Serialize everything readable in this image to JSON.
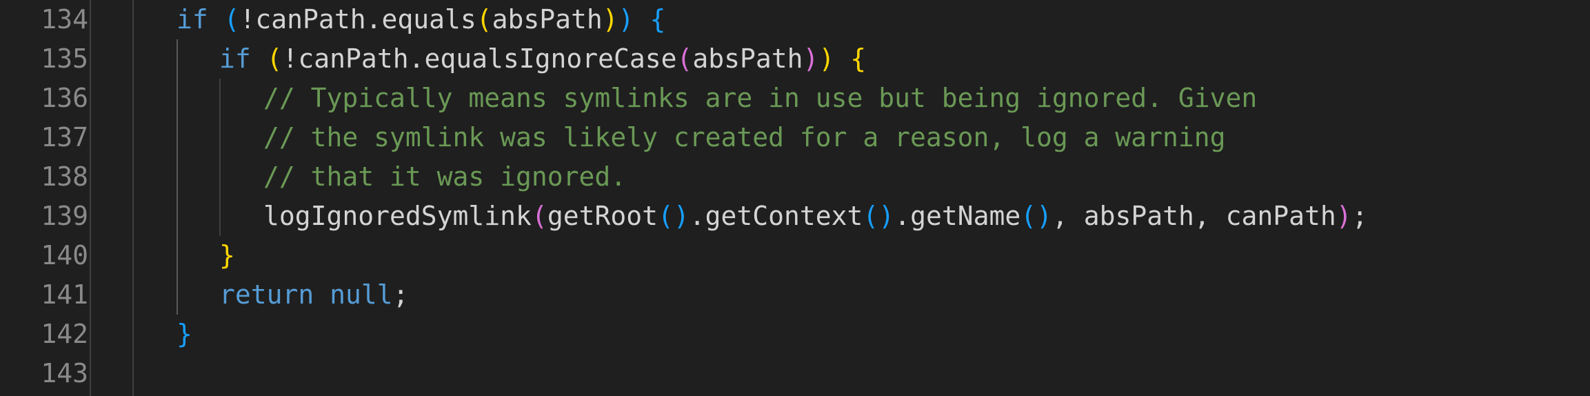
{
  "editor": {
    "line_numbers": [
      "134",
      "135",
      "136",
      "137",
      "138",
      "139",
      "140",
      "141",
      "142",
      "143"
    ],
    "colors": {
      "background": "#1f1f1f",
      "line_number": "#8a8a8a",
      "keyword": "#569cd6",
      "identifier": "#d4d4d4",
      "comment": "#6a9955",
      "bracket_level_1": "#ffd700",
      "bracket_level_2": "#da70d6",
      "bracket_level_3": "#179fff"
    },
    "lines": [
      {
        "number": "134",
        "tokens": [
          {
            "t": "if",
            "c": "kw"
          },
          {
            "t": " ",
            "c": "id"
          },
          {
            "t": "(",
            "c": "b3"
          },
          {
            "t": "!canPath.equals",
            "c": "id"
          },
          {
            "t": "(",
            "c": "b1"
          },
          {
            "t": "absPath",
            "c": "id"
          },
          {
            "t": ")",
            "c": "b1"
          },
          {
            "t": ")",
            "c": "b3"
          },
          {
            "t": " ",
            "c": "id"
          },
          {
            "t": "{",
            "c": "b3"
          }
        ]
      },
      {
        "number": "135",
        "tokens": [
          {
            "t": "if",
            "c": "kw"
          },
          {
            "t": " ",
            "c": "id"
          },
          {
            "t": "(",
            "c": "b1"
          },
          {
            "t": "!canPath.equalsIgnoreCase",
            "c": "id"
          },
          {
            "t": "(",
            "c": "b2"
          },
          {
            "t": "absPath",
            "c": "id"
          },
          {
            "t": ")",
            "c": "b2"
          },
          {
            "t": ")",
            "c": "b1"
          },
          {
            "t": " ",
            "c": "id"
          },
          {
            "t": "{",
            "c": "b1"
          }
        ]
      },
      {
        "number": "136",
        "tokens": [
          {
            "t": "// Typically means symlinks are in use but being ignored. Given",
            "c": "cm"
          }
        ]
      },
      {
        "number": "137",
        "tokens": [
          {
            "t": "// the symlink was likely created for a reason, log a warning",
            "c": "cm"
          }
        ]
      },
      {
        "number": "138",
        "tokens": [
          {
            "t": "// that it was ignored.",
            "c": "cm"
          }
        ]
      },
      {
        "number": "139",
        "tokens": [
          {
            "t": "logIgnoredSymlink",
            "c": "id"
          },
          {
            "t": "(",
            "c": "b2"
          },
          {
            "t": "getRoot",
            "c": "id"
          },
          {
            "t": "()",
            "c": "b3"
          },
          {
            "t": ".getContext",
            "c": "id"
          },
          {
            "t": "()",
            "c": "b3"
          },
          {
            "t": ".getName",
            "c": "id"
          },
          {
            "t": "()",
            "c": "b3"
          },
          {
            "t": ", absPath, canPath",
            "c": "id"
          },
          {
            "t": ")",
            "c": "b2"
          },
          {
            "t": ";",
            "c": "id"
          }
        ]
      },
      {
        "number": "140",
        "tokens": [
          {
            "t": "}",
            "c": "b1"
          }
        ]
      },
      {
        "number": "141",
        "tokens": [
          {
            "t": "return",
            "c": "kw"
          },
          {
            "t": " ",
            "c": "id"
          },
          {
            "t": "null",
            "c": "kw"
          },
          {
            "t": ";",
            "c": "id"
          }
        ]
      },
      {
        "number": "142",
        "tokens": [
          {
            "t": "}",
            "c": "b3"
          }
        ]
      },
      {
        "number": "143",
        "tokens": []
      }
    ]
  }
}
